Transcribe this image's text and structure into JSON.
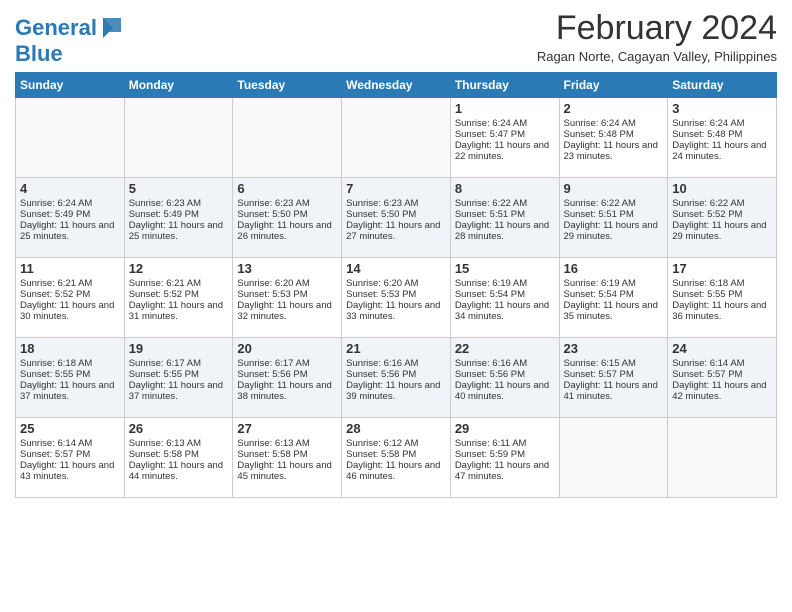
{
  "logo": {
    "line1": "General",
    "line2": "Blue"
  },
  "title": "February 2024",
  "subtitle": "Ragan Norte, Cagayan Valley, Philippines",
  "days_of_week": [
    "Sunday",
    "Monday",
    "Tuesday",
    "Wednesday",
    "Thursday",
    "Friday",
    "Saturday"
  ],
  "weeks": [
    [
      {
        "day": "",
        "sunrise": "",
        "sunset": "",
        "daylight": ""
      },
      {
        "day": "",
        "sunrise": "",
        "sunset": "",
        "daylight": ""
      },
      {
        "day": "",
        "sunrise": "",
        "sunset": "",
        "daylight": ""
      },
      {
        "day": "",
        "sunrise": "",
        "sunset": "",
        "daylight": ""
      },
      {
        "day": "1",
        "sunrise": "Sunrise: 6:24 AM",
        "sunset": "Sunset: 5:47 PM",
        "daylight": "Daylight: 11 hours and 22 minutes."
      },
      {
        "day": "2",
        "sunrise": "Sunrise: 6:24 AM",
        "sunset": "Sunset: 5:48 PM",
        "daylight": "Daylight: 11 hours and 23 minutes."
      },
      {
        "day": "3",
        "sunrise": "Sunrise: 6:24 AM",
        "sunset": "Sunset: 5:48 PM",
        "daylight": "Daylight: 11 hours and 24 minutes."
      }
    ],
    [
      {
        "day": "4",
        "sunrise": "Sunrise: 6:24 AM",
        "sunset": "Sunset: 5:49 PM",
        "daylight": "Daylight: 11 hours and 25 minutes."
      },
      {
        "day": "5",
        "sunrise": "Sunrise: 6:23 AM",
        "sunset": "Sunset: 5:49 PM",
        "daylight": "Daylight: 11 hours and 25 minutes."
      },
      {
        "day": "6",
        "sunrise": "Sunrise: 6:23 AM",
        "sunset": "Sunset: 5:50 PM",
        "daylight": "Daylight: 11 hours and 26 minutes."
      },
      {
        "day": "7",
        "sunrise": "Sunrise: 6:23 AM",
        "sunset": "Sunset: 5:50 PM",
        "daylight": "Daylight: 11 hours and 27 minutes."
      },
      {
        "day": "8",
        "sunrise": "Sunrise: 6:22 AM",
        "sunset": "Sunset: 5:51 PM",
        "daylight": "Daylight: 11 hours and 28 minutes."
      },
      {
        "day": "9",
        "sunrise": "Sunrise: 6:22 AM",
        "sunset": "Sunset: 5:51 PM",
        "daylight": "Daylight: 11 hours and 29 minutes."
      },
      {
        "day": "10",
        "sunrise": "Sunrise: 6:22 AM",
        "sunset": "Sunset: 5:52 PM",
        "daylight": "Daylight: 11 hours and 29 minutes."
      }
    ],
    [
      {
        "day": "11",
        "sunrise": "Sunrise: 6:21 AM",
        "sunset": "Sunset: 5:52 PM",
        "daylight": "Daylight: 11 hours and 30 minutes."
      },
      {
        "day": "12",
        "sunrise": "Sunrise: 6:21 AM",
        "sunset": "Sunset: 5:52 PM",
        "daylight": "Daylight: 11 hours and 31 minutes."
      },
      {
        "day": "13",
        "sunrise": "Sunrise: 6:20 AM",
        "sunset": "Sunset: 5:53 PM",
        "daylight": "Daylight: 11 hours and 32 minutes."
      },
      {
        "day": "14",
        "sunrise": "Sunrise: 6:20 AM",
        "sunset": "Sunset: 5:53 PM",
        "daylight": "Daylight: 11 hours and 33 minutes."
      },
      {
        "day": "15",
        "sunrise": "Sunrise: 6:19 AM",
        "sunset": "Sunset: 5:54 PM",
        "daylight": "Daylight: 11 hours and 34 minutes."
      },
      {
        "day": "16",
        "sunrise": "Sunrise: 6:19 AM",
        "sunset": "Sunset: 5:54 PM",
        "daylight": "Daylight: 11 hours and 35 minutes."
      },
      {
        "day": "17",
        "sunrise": "Sunrise: 6:18 AM",
        "sunset": "Sunset: 5:55 PM",
        "daylight": "Daylight: 11 hours and 36 minutes."
      }
    ],
    [
      {
        "day": "18",
        "sunrise": "Sunrise: 6:18 AM",
        "sunset": "Sunset: 5:55 PM",
        "daylight": "Daylight: 11 hours and 37 minutes."
      },
      {
        "day": "19",
        "sunrise": "Sunrise: 6:17 AM",
        "sunset": "Sunset: 5:55 PM",
        "daylight": "Daylight: 11 hours and 37 minutes."
      },
      {
        "day": "20",
        "sunrise": "Sunrise: 6:17 AM",
        "sunset": "Sunset: 5:56 PM",
        "daylight": "Daylight: 11 hours and 38 minutes."
      },
      {
        "day": "21",
        "sunrise": "Sunrise: 6:16 AM",
        "sunset": "Sunset: 5:56 PM",
        "daylight": "Daylight: 11 hours and 39 minutes."
      },
      {
        "day": "22",
        "sunrise": "Sunrise: 6:16 AM",
        "sunset": "Sunset: 5:56 PM",
        "daylight": "Daylight: 11 hours and 40 minutes."
      },
      {
        "day": "23",
        "sunrise": "Sunrise: 6:15 AM",
        "sunset": "Sunset: 5:57 PM",
        "daylight": "Daylight: 11 hours and 41 minutes."
      },
      {
        "day": "24",
        "sunrise": "Sunrise: 6:14 AM",
        "sunset": "Sunset: 5:57 PM",
        "daylight": "Daylight: 11 hours and 42 minutes."
      }
    ],
    [
      {
        "day": "25",
        "sunrise": "Sunrise: 6:14 AM",
        "sunset": "Sunset: 5:57 PM",
        "daylight": "Daylight: 11 hours and 43 minutes."
      },
      {
        "day": "26",
        "sunrise": "Sunrise: 6:13 AM",
        "sunset": "Sunset: 5:58 PM",
        "daylight": "Daylight: 11 hours and 44 minutes."
      },
      {
        "day": "27",
        "sunrise": "Sunrise: 6:13 AM",
        "sunset": "Sunset: 5:58 PM",
        "daylight": "Daylight: 11 hours and 45 minutes."
      },
      {
        "day": "28",
        "sunrise": "Sunrise: 6:12 AM",
        "sunset": "Sunset: 5:58 PM",
        "daylight": "Daylight: 11 hours and 46 minutes."
      },
      {
        "day": "29",
        "sunrise": "Sunrise: 6:11 AM",
        "sunset": "Sunset: 5:59 PM",
        "daylight": "Daylight: 11 hours and 47 minutes."
      },
      {
        "day": "",
        "sunrise": "",
        "sunset": "",
        "daylight": ""
      },
      {
        "day": "",
        "sunrise": "",
        "sunset": "",
        "daylight": ""
      }
    ]
  ]
}
